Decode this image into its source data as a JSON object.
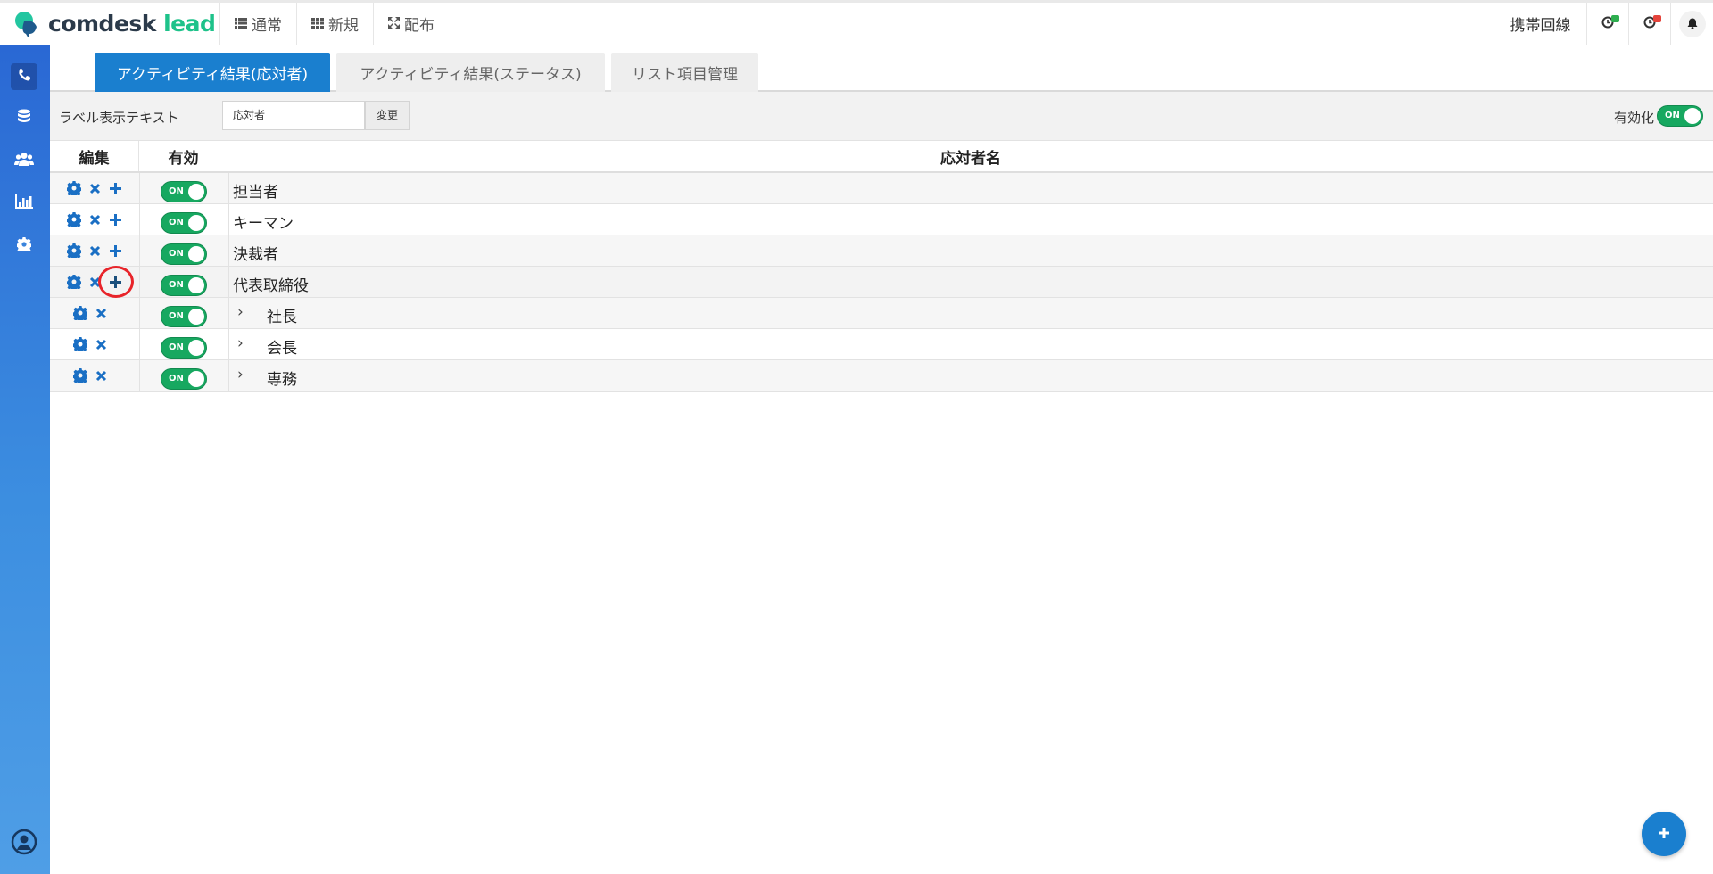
{
  "brand": {
    "name": "comdesk",
    "suffix": " lead"
  },
  "nav": {
    "items": [
      {
        "label": "通常",
        "icon": "list-icon"
      },
      {
        "label": "新規",
        "icon": "grid-icon"
      },
      {
        "label": "配布",
        "icon": "expand-arrows-icon"
      }
    ]
  },
  "topright": {
    "phone_label": "携帯回線",
    "status_icons": [
      {
        "icon": "clock-icon",
        "badge_color": "#2eae4f"
      },
      {
        "icon": "clock-icon",
        "badge_color": "#e4433b"
      }
    ],
    "bell_icon": "bell-icon"
  },
  "sidebar": {
    "items": [
      {
        "icon": "phone-icon",
        "active": true
      },
      {
        "icon": "database-icon",
        "active": false
      },
      {
        "icon": "users-icon",
        "active": false
      },
      {
        "icon": "bar-chart-icon",
        "active": false
      },
      {
        "icon": "gear-icon",
        "active": false
      }
    ],
    "footer_icon": "user-circle-icon"
  },
  "tabs": [
    {
      "label": "アクティビティ結果(応対者)",
      "active": true
    },
    {
      "label": "アクティビティ結果(ステータス)",
      "active": false
    },
    {
      "label": "リスト項目管理",
      "active": false
    }
  ],
  "label_bar": {
    "label": "ラベル表示テキスト",
    "input_value": "応対者",
    "change_button": "変更",
    "enable_label": "有効化",
    "enable_toggle": "ON"
  },
  "table": {
    "headers": {
      "edit": "編集",
      "enabled": "有効",
      "name": "応対者名"
    },
    "rows": [
      {
        "name": "担当者",
        "toggle": "ON",
        "child": false,
        "actions": [
          "gear-icon",
          "close-icon",
          "plus-icon"
        ]
      },
      {
        "name": "キーマン",
        "toggle": "ON",
        "child": false,
        "actions": [
          "gear-icon",
          "close-icon",
          "plus-icon"
        ]
      },
      {
        "name": "決裁者",
        "toggle": "ON",
        "child": false,
        "actions": [
          "gear-icon",
          "close-icon",
          "plus-icon"
        ]
      },
      {
        "name": "代表取締役",
        "toggle": "ON",
        "child": false,
        "actions": [
          "gear-icon",
          "close-icon",
          "plus-icon"
        ],
        "highlighted_action": "plus-icon"
      },
      {
        "name": "社長",
        "toggle": "ON",
        "child": true,
        "actions": [
          "gear-icon",
          "close-icon"
        ]
      },
      {
        "name": "会長",
        "toggle": "ON",
        "child": true,
        "actions": [
          "gear-icon",
          "close-icon"
        ]
      },
      {
        "name": "専務",
        "toggle": "ON",
        "child": true,
        "actions": [
          "gear-icon",
          "close-icon"
        ]
      }
    ],
    "child_marker": "›"
  },
  "fab": {
    "icon": "plus-icon"
  },
  "colors": {
    "accent": "#1a7fcf",
    "toggle_on": "#17a860",
    "highlight": "#e8242a",
    "brand_green": "#1ec28a"
  }
}
